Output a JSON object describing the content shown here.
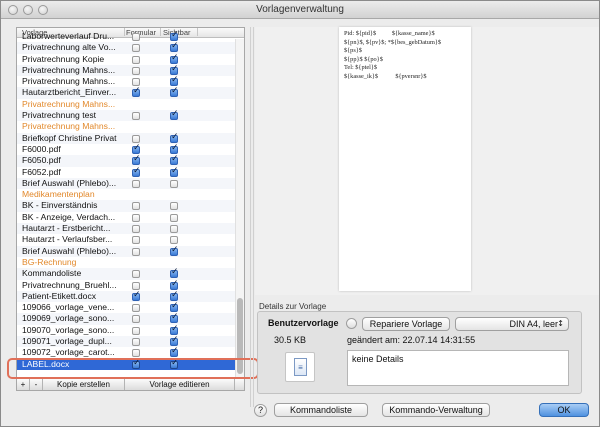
{
  "window": {
    "title": "Vorlagenverwaltung"
  },
  "list": {
    "columns": {
      "vorlage": "Vorlage",
      "formular": "Formular",
      "sichtbar": "Sichtbar"
    },
    "rows": [
      {
        "label": "Laborwerteverlauf Dru...",
        "type": "item",
        "formular": false,
        "sichtbar": true
      },
      {
        "label": "Privatrechnung alte Vo...",
        "type": "item",
        "formular": false,
        "sichtbar": true
      },
      {
        "label": "Privatrechnung Kopie",
        "type": "item",
        "formular": false,
        "sichtbar": true
      },
      {
        "label": "Privatrechnung Mahns...",
        "type": "item",
        "formular": false,
        "sichtbar": true
      },
      {
        "label": "Privatrechnung Mahns...",
        "type": "item",
        "formular": false,
        "sichtbar": true
      },
      {
        "label": "Hautarztbericht_Einver...",
        "type": "item",
        "formular": true,
        "sichtbar": true
      },
      {
        "label": "Privatrechnung Mahns...",
        "type": "group"
      },
      {
        "label": "Privatrechnung test",
        "type": "item",
        "formular": false,
        "sichtbar": true
      },
      {
        "label": "Privatrechnung Mahns...",
        "type": "group"
      },
      {
        "label": "Briefkopf Christine Privat",
        "type": "item",
        "formular": false,
        "sichtbar": true
      },
      {
        "label": "F6000.pdf",
        "type": "item",
        "formular": true,
        "sichtbar": true
      },
      {
        "label": "F6050.pdf",
        "type": "item",
        "formular": true,
        "sichtbar": true
      },
      {
        "label": "F6052.pdf",
        "type": "item",
        "formular": true,
        "sichtbar": true
      },
      {
        "label": "Brief Auswahl (Phlebo)...",
        "type": "item",
        "formular": false,
        "sichtbar": false
      },
      {
        "label": "Medikamentenplan",
        "type": "group"
      },
      {
        "label": "BK - Einverständnis",
        "type": "item",
        "formular": false,
        "sichtbar": false
      },
      {
        "label": "BK - Anzeige, Verdach...",
        "type": "item",
        "formular": false,
        "sichtbar": false
      },
      {
        "label": "Hautarzt - Erstbericht...",
        "type": "item",
        "formular": false,
        "sichtbar": false
      },
      {
        "label": "Hautarzt - Verlaufsber...",
        "type": "item",
        "formular": false,
        "sichtbar": false
      },
      {
        "label": "Brief Auswahl (Phlebo)...",
        "type": "item",
        "formular": false,
        "sichtbar": true
      },
      {
        "label": "BG-Rechnung",
        "type": "group"
      },
      {
        "label": "Kommandoliste",
        "type": "item",
        "formular": false,
        "sichtbar": true
      },
      {
        "label": "Privatrechnung_Bruehl...",
        "type": "item",
        "formular": false,
        "sichtbar": true
      },
      {
        "label": "Patient-Etikett.docx",
        "type": "item",
        "formular": true,
        "sichtbar": true
      },
      {
        "label": "109066_vorlage_vene...",
        "type": "item",
        "formular": false,
        "sichtbar": true
      },
      {
        "label": "109069_vorlage_sono...",
        "type": "item",
        "formular": false,
        "sichtbar": true
      },
      {
        "label": "109070_vorlage_sono...",
        "type": "item",
        "formular": false,
        "sichtbar": true
      },
      {
        "label": "109071_vorlage_dupl...",
        "type": "item",
        "formular": false,
        "sichtbar": true
      },
      {
        "label": "109072_vorlage_carot...",
        "type": "item",
        "formular": false,
        "sichtbar": true
      },
      {
        "label": "LABEL.docx",
        "type": "item",
        "formular": true,
        "sichtbar": true,
        "selected": true
      }
    ]
  },
  "bottom_bar": {
    "add": "+",
    "remove": "-",
    "copy": "Kopie erstellen",
    "edit": "Vorlage editieren"
  },
  "preview": {
    "lines": [
      "Pid: ${pid}$          ${kasse_name}$",
      "${pn}$, ${pv}$; *${bes_gebDatum}$",
      "${ps}$",
      "${pp}$ ${po}$",
      "Tel: ${ptel}$",
      "${kasse_ik}$           ${pversnr}$"
    ]
  },
  "details": {
    "section_label": "Details zur Vorlage",
    "title": "Benutzervorlage",
    "size": "30.5 KB",
    "repair_button": "Repariere Vorlage",
    "format_select": "DIN A4, leer",
    "changed": "geändert am:  22.07.14  14:31:55",
    "description": "keine Details"
  },
  "footer": {
    "help": "?",
    "kommandoliste": "Kommandoliste",
    "kommando_verwaltung": "Kommando-Verwaltung",
    "ok": "OK"
  }
}
